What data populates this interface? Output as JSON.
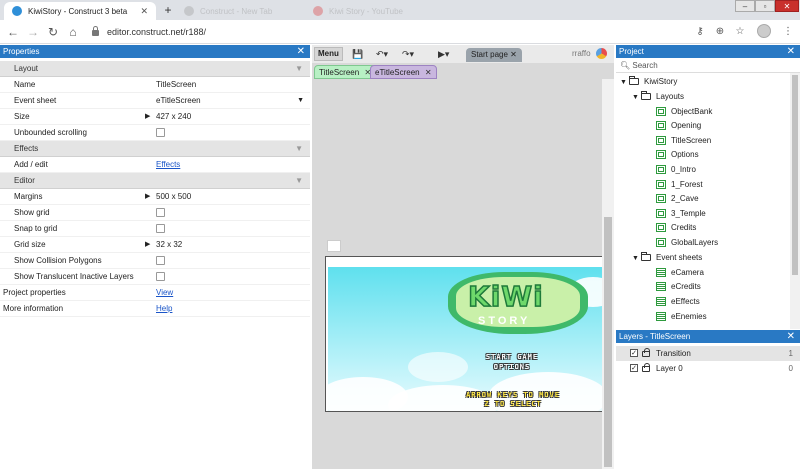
{
  "browser": {
    "tabs": [
      {
        "title": "KiwiStory - Construct 3 beta",
        "active": true
      },
      {
        "title": "Construct - New Tab",
        "active": false
      },
      {
        "title": "Kiwi Story - YouTube",
        "active": false
      }
    ],
    "url": "editor.construct.net/r188/",
    "colors": {
      "tabstrip": "#dee1e6",
      "panel_header": "#2979c4"
    }
  },
  "properties": {
    "title": "Properties",
    "sections": {
      "layout": "Layout",
      "effects": "Effects",
      "editor": "Editor"
    },
    "rows": {
      "name": {
        "label": "Name",
        "value": "TitleScreen"
      },
      "event_sheet": {
        "label": "Event sheet",
        "value": "eTitleScreen"
      },
      "size": {
        "label": "Size",
        "value": "427 x 240"
      },
      "unbounded": {
        "label": "Unbounded scrolling"
      },
      "add_edit": {
        "label": "Add / edit",
        "value": "Effects"
      },
      "margins": {
        "label": "Margins",
        "value": "500 x 500"
      },
      "show_grid": {
        "label": "Show grid"
      },
      "snap_grid": {
        "label": "Snap to grid"
      },
      "grid_size": {
        "label": "Grid size",
        "value": "32 x 32"
      },
      "collision": {
        "label": "Show Collision Polygons"
      },
      "translucent": {
        "label": "Show Translucent Inactive Layers"
      },
      "project_props": {
        "label": "Project properties",
        "value": "View"
      },
      "more_info": {
        "label": "More information",
        "value": "Help"
      }
    }
  },
  "editor": {
    "menu_label": "Menu",
    "start_tab": "Start page",
    "user": "rraffo",
    "doc_tabs": [
      "TitleScreen",
      "eTitleScreen"
    ],
    "game": {
      "logo": "KiWi",
      "logo_sub": "STORY",
      "menu_line1": "START GAME",
      "menu_line2": "OPTIONS",
      "hint_line1": "ARROW KEYS TO MOVE",
      "hint_line2": "Z TO SELECT"
    }
  },
  "project": {
    "title": "Project",
    "search_placeholder": "Search",
    "root": "KiwiStory",
    "layouts_folder": "Layouts",
    "layouts": [
      "ObjectBank",
      "Opening",
      "TitleScreen",
      "Options",
      "0_Intro",
      "1_Forest",
      "2_Cave",
      "3_Temple",
      "Credits",
      "GlobalLayers"
    ],
    "eventsheets_folder": "Event sheets",
    "eventsheets": [
      "eCamera",
      "eCredits",
      "eEffects",
      "eEnemies"
    ]
  },
  "layers": {
    "title": "Layers - TitleScreen",
    "items": [
      {
        "name": "Transition",
        "index": "1"
      },
      {
        "name": "Layer 0",
        "index": "0"
      }
    ]
  }
}
